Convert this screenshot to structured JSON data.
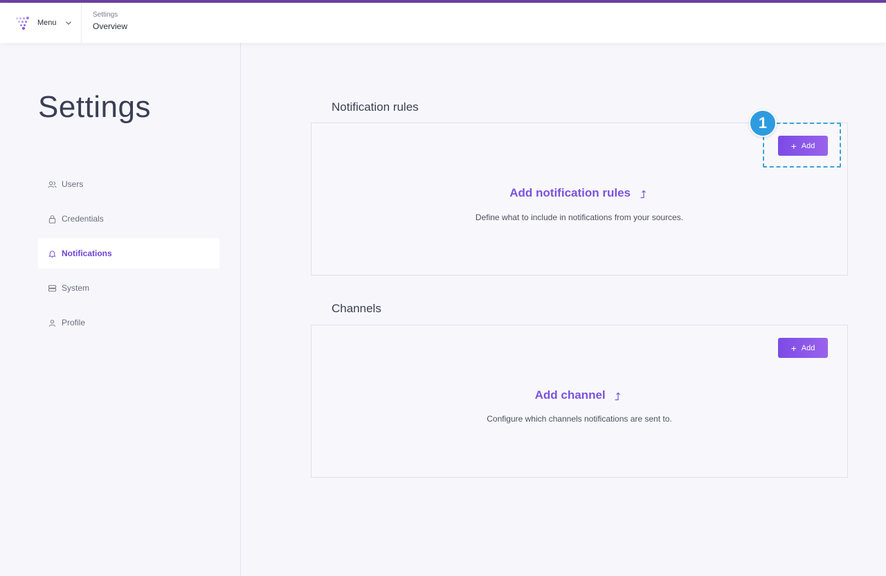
{
  "header": {
    "menu_label": "Menu",
    "breadcrumb_parent": "Settings",
    "breadcrumb_current": "Overview"
  },
  "sidebar": {
    "title": "Settings",
    "items": [
      {
        "label": "Users",
        "icon": "users-icon"
      },
      {
        "label": "Credentials",
        "icon": "lock-icon"
      },
      {
        "label": "Notifications",
        "icon": "bell-icon",
        "active": true
      },
      {
        "label": "System",
        "icon": "server-icon"
      },
      {
        "label": "Profile",
        "icon": "user-icon"
      }
    ]
  },
  "sections": {
    "notification_rules": {
      "title": "Notification rules",
      "add_label": "Add",
      "link": "Add notification rules",
      "description": "Define what to include in notifications from your sources."
    },
    "channels": {
      "title": "Channels",
      "add_label": "Add",
      "link": "Add channel",
      "description": "Configure which channels notifications are sent to."
    }
  },
  "annotation": {
    "step": "1"
  },
  "colors": {
    "accent": "#7b52dd",
    "topline": "#6b3fa0",
    "annotation": "#2e9be0"
  }
}
